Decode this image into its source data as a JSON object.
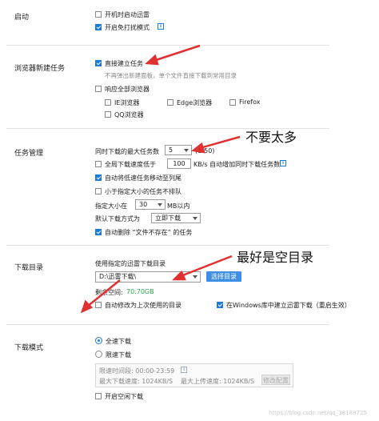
{
  "startup": {
    "title": "启动",
    "auto_start": "开机时启动迅雷",
    "disturb_free": "开启免打扰模式"
  },
  "browser": {
    "title": "浏览器新建任务",
    "direct_create": "直接建立任务",
    "direct_create_desc": "不再弹出新建面板，单个文件直接下载到常用目录",
    "respond_all": "响应全部浏览器",
    "ie": "IE浏览器",
    "edge": "Edge浏览器",
    "firefox": "Firefox",
    "qq": "QQ浏览器"
  },
  "task": {
    "title": "任务管理",
    "max_label": "同时下载的最大任务数",
    "max_value": "5",
    "max_range": "(1-50)",
    "speed_below": "全局下载速度低于",
    "speed_value": "100",
    "speed_suffix": "KB/s 自动增加同时下载任务数",
    "move_slow": "自动将低速任务移动至列尾",
    "exclude_small": "小于指定大小的任务不排队",
    "size_label": "指定大小在",
    "size_value": "30",
    "size_unit": "MB以内",
    "default_mode_label": "默认下载方式为",
    "default_mode_value": "立即下载",
    "auto_delete": "自动删除 “文件不存在” 的任务"
  },
  "dir": {
    "title": "下载目录",
    "use_dir_label": "使用指定的迅雷下载目录",
    "path": "D:\\迅雷下载\\",
    "choose_btn": "选择目录",
    "free_label": "剩余空间:",
    "free_value": "70.70GB",
    "auto_modify": "自动修改为上次使用的目录",
    "create_in_lib": "在Windows库中建立迅雷下载（重启生效）"
  },
  "mode": {
    "title": "下载模式",
    "full_speed": "全速下载",
    "limited": "限速下载",
    "limit_time": "限速时间段:  00:00-23:59",
    "max_download": "最大下载速度:  1024KB/S",
    "max_upload": "最大上传速度:  1024KB/S",
    "modify_btn": "修改配置",
    "open_idle": "开启空闲下载"
  },
  "annotations": {
    "not_too_many": "不要太多",
    "empty_dir": "最好是空目录"
  },
  "watermark": "https://blog.csdn.net/qq_38188725",
  "colors": {
    "accent": "#1e7ad9",
    "free_space": "#2aa84a",
    "arrow": "#e03030"
  }
}
